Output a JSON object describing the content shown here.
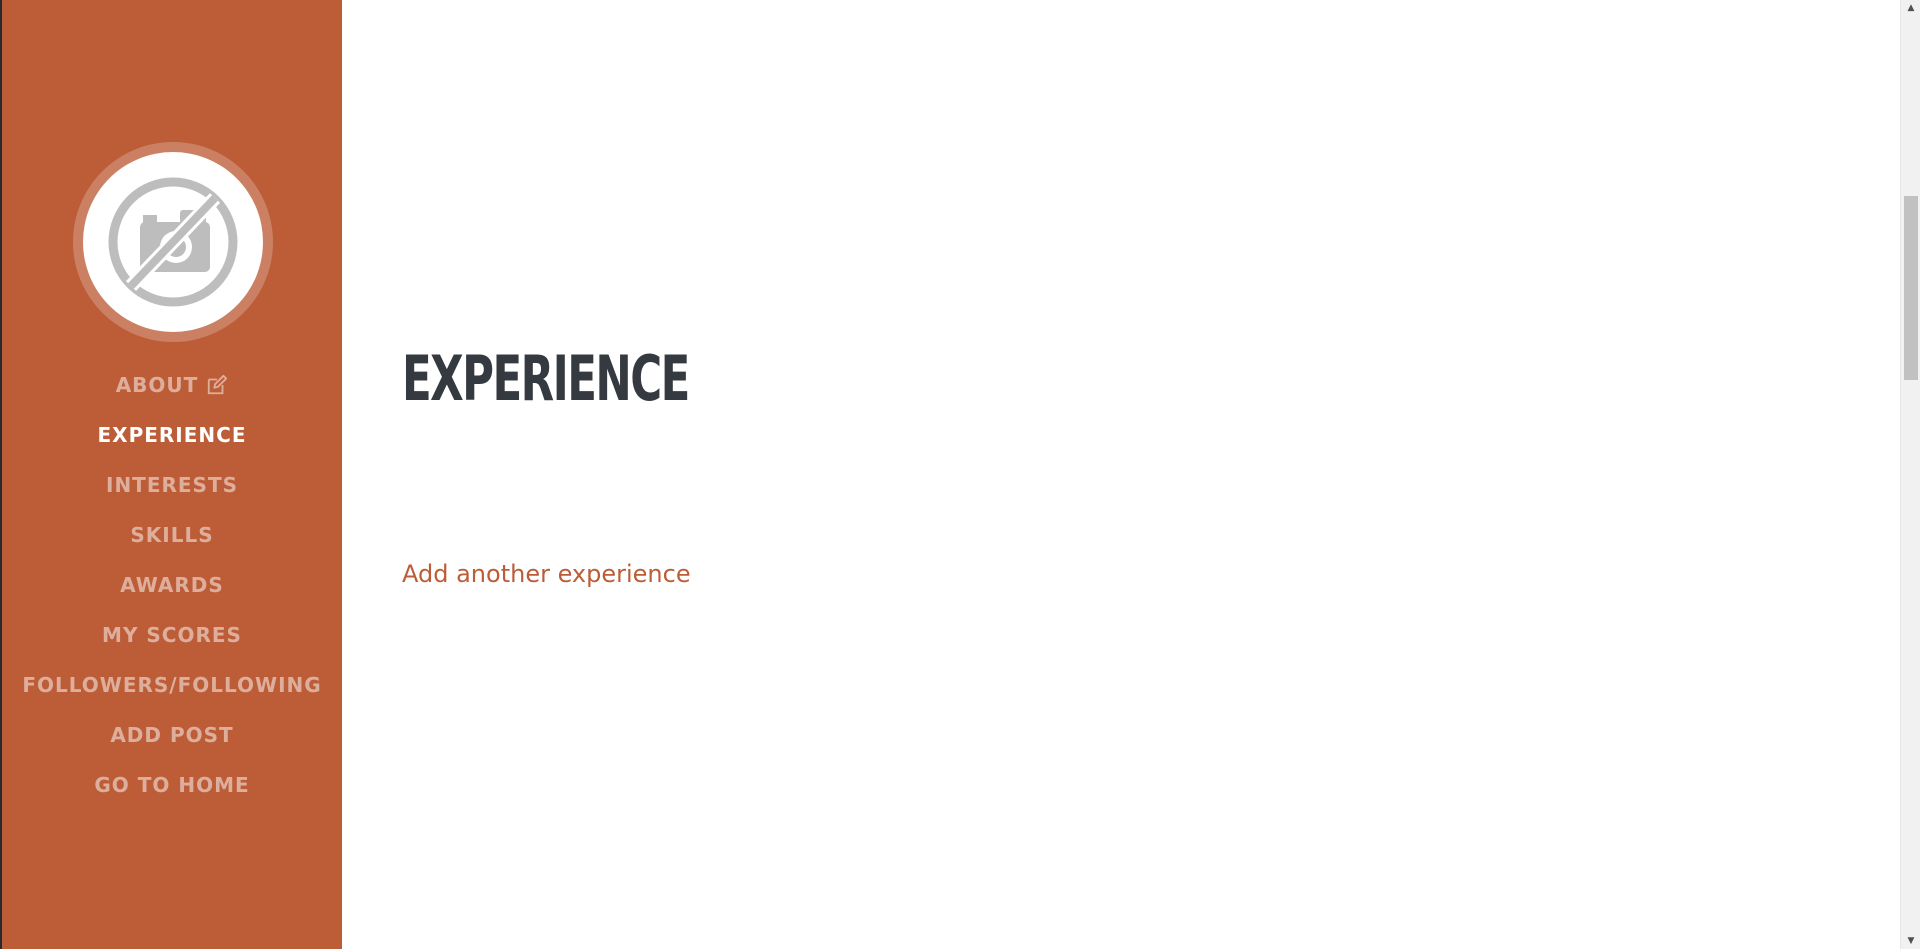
{
  "sidebar": {
    "avatar_icon": "no-photo-icon",
    "edit_icon": "edit-icon",
    "items": [
      {
        "label": "ABOUT",
        "active": false
      },
      {
        "label": "EXPERIENCE",
        "active": true
      },
      {
        "label": "INTERESTS",
        "active": false
      },
      {
        "label": "SKILLS",
        "active": false
      },
      {
        "label": "AWARDS",
        "active": false
      },
      {
        "label": "MY SCORES",
        "active": false
      },
      {
        "label": "FOLLOWERS/FOLLOWING",
        "active": false
      },
      {
        "label": "ADD POST",
        "active": false
      },
      {
        "label": "GO TO HOME",
        "active": false
      }
    ]
  },
  "main": {
    "section_title": "EXPERIENCE",
    "add_link": "Add another experience"
  },
  "colors": {
    "sidebar_bg": "#bd5d38",
    "title": "#343a40",
    "link": "#bd5d38"
  },
  "scrollbar": {
    "up_arrow": "▲",
    "down_arrow": "▼"
  }
}
